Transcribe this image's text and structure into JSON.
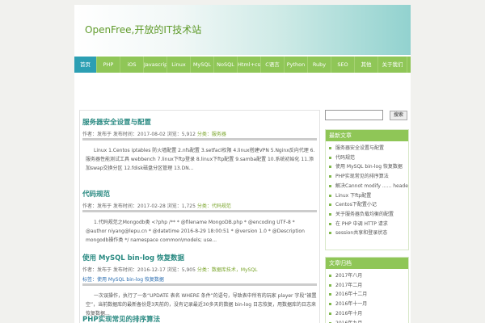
{
  "site": {
    "title": "OpenFree,开放的IT技术站"
  },
  "nav": {
    "items": [
      {
        "label": "首页",
        "width": 28,
        "active": true
      },
      {
        "label": "PHP",
        "width": 29
      },
      {
        "label": "iOS",
        "width": 29
      },
      {
        "label": "Javascript",
        "width": 29
      },
      {
        "label": "Linux",
        "width": 29
      },
      {
        "label": "MySQL",
        "width": 29
      },
      {
        "label": "NoSQL",
        "width": 29
      },
      {
        "label": "Html+css",
        "width": 29
      },
      {
        "label": "C语言",
        "width": 29
      },
      {
        "label": "Python",
        "width": 29
      },
      {
        "label": "Ruby",
        "width": 29
      },
      {
        "label": "SEO",
        "width": 29
      },
      {
        "label": "其他",
        "width": 29
      },
      {
        "label": "关于我们",
        "width": 36
      }
    ]
  },
  "posts": [
    {
      "title": "服务器安全设置与配置",
      "meta_prefix": "作者：发布于 发布时间：",
      "date": "2017-08-02",
      "views": "浏览：5,912",
      "category": "分类：服务器",
      "excerpt": "Linux 1.Centos iptables 防火墙配置 2.nfs配置 3.setfacl权限 4.linux搭建VPN 5.Nginx反向代理 6.服务器性能测试工具 webbench 7.linux下ftp登录 8.linux下ftp配置 9.samba配置 10.系统初始化 11.添加swap交换分区 12.fdisk磁盘分区管理 13.DN..."
    },
    {
      "title": "代码规范",
      "meta_prefix": "作者：发布于 发布时间：",
      "date": "2017-02-28",
      "views": "浏览：1,725",
      "category": "分类：代码规范",
      "excerpt": "1.代码规范之Mongodb类 <?php /** * @filename MongoDB.php * @encoding UTF-8 * @author niyang@lepu.cn * @datetime 2016-8-29 18:00:51 * @version 1.0 * @Description mongodb操作类 */ namespace common\\models; use..."
    },
    {
      "title": "使用 MySQL bin-log 恢复数据",
      "meta_prefix": "作者：发布于 发布时间：",
      "date": "2016-12-17",
      "views": "浏览：5,905",
      "category": "分类：数据库技术，MySQL",
      "tags": "标签：使用 MySQL bin-log 恢复数据",
      "excerpt": "一次误操作，执行了一条“UPDATE 表名 WHERE 条件”的语句，导致表中所有的玩家 player 字段“被置空”，当前数据库的最新备份是3天前的，没有记录最近30多天的数据 bin-log 日志恢复，用数据库的日志来恢复数据..."
    },
    {
      "title": "PHP实现常见的排序算法"
    }
  ],
  "sidebar": {
    "search_button": "搜索",
    "recent_title": "最新文章",
    "recent": [
      "服务器安全设置与配置",
      "代码规范",
      "使用 MySQL bin-log 恢复数据",
      "PHP实现常见的排序算法",
      "解决Cannot modify ...... headers already sent by",
      "Linux 下ftp配置",
      "Centos下配置小记",
      "关于服务器负载均衡的配置",
      "在 PHP 中调 HTTP 请求",
      "session共享和登录状态"
    ],
    "archive_title": "文章归档",
    "archives": [
      "2017年八月",
      "2017年二月",
      "2016年十二月",
      "2016年十一月",
      "2016年十月",
      "2016年九月"
    ]
  }
}
